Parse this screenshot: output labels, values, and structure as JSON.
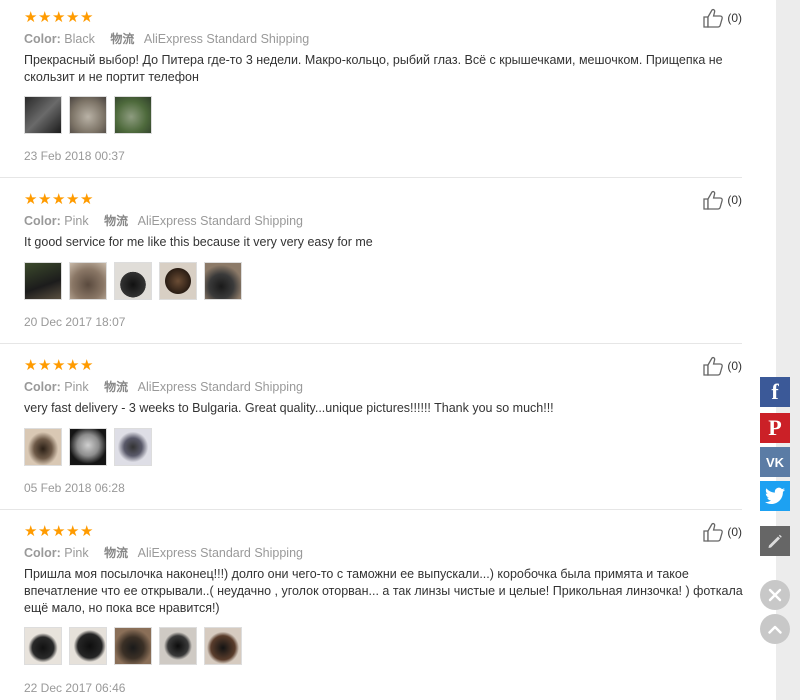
{
  "reviews": [
    {
      "stars": 5,
      "color_label": "Color:",
      "color_value": "Black",
      "shipping_label": "物流",
      "shipping_value": "AliExpress Standard Shipping",
      "text": "Прекрасный выбор! До Питера где-то 3 недели. Макро-кольцо, рыбий глаз. Всё с крышечками, мешочком. Прищепка не скользит и не портит телефон",
      "photos": 3,
      "date": "23 Feb 2018 00:37",
      "helpful_count": "(0)"
    },
    {
      "stars": 5,
      "color_label": "Color:",
      "color_value": "Pink",
      "shipping_label": "物流",
      "shipping_value": "AliExpress Standard Shipping",
      "text": "It good service for me like this because it very very easy for me",
      "photos": 5,
      "date": "20 Dec 2017 18:07",
      "helpful_count": "(0)"
    },
    {
      "stars": 5,
      "color_label": "Color:",
      "color_value": "Pink",
      "shipping_label": "物流",
      "shipping_value": "AliExpress Standard Shipping",
      "text": "very fast delivery - 3 weeks to Bulgaria. Great quality...unique pictures!!!!!! Thank you so much!!!",
      "photos": 3,
      "date": "05 Feb 2018 06:28",
      "helpful_count": "(0)"
    },
    {
      "stars": 5,
      "color_label": "Color:",
      "color_value": "Pink",
      "shipping_label": "物流",
      "shipping_value": "AliExpress Standard Shipping",
      "text": "Пришла моя посылочка наконец!!!) долго они чего-то с таможни ее выпускали...) коробочка была примята и такое впечатление что ее открывали..( неудачно , уголок оторван... а так линзы чистые и целые! Прикольная линзочка! ) фоткала ещё мало, но пока все нравится!)",
      "photos": 5,
      "date": "22 Dec 2017 06:46",
      "helpful_count": "(0)"
    }
  ],
  "social": {
    "facebook": "f",
    "pinterest": "P",
    "vk": "VK",
    "twitter": "twitter-bird",
    "edit": "pencil"
  },
  "colors": {
    "star": "#ff9b00",
    "facebook": "#3b5998",
    "pinterest": "#cb2027",
    "vk": "#5b7ca5",
    "twitter": "#1da1f2"
  }
}
